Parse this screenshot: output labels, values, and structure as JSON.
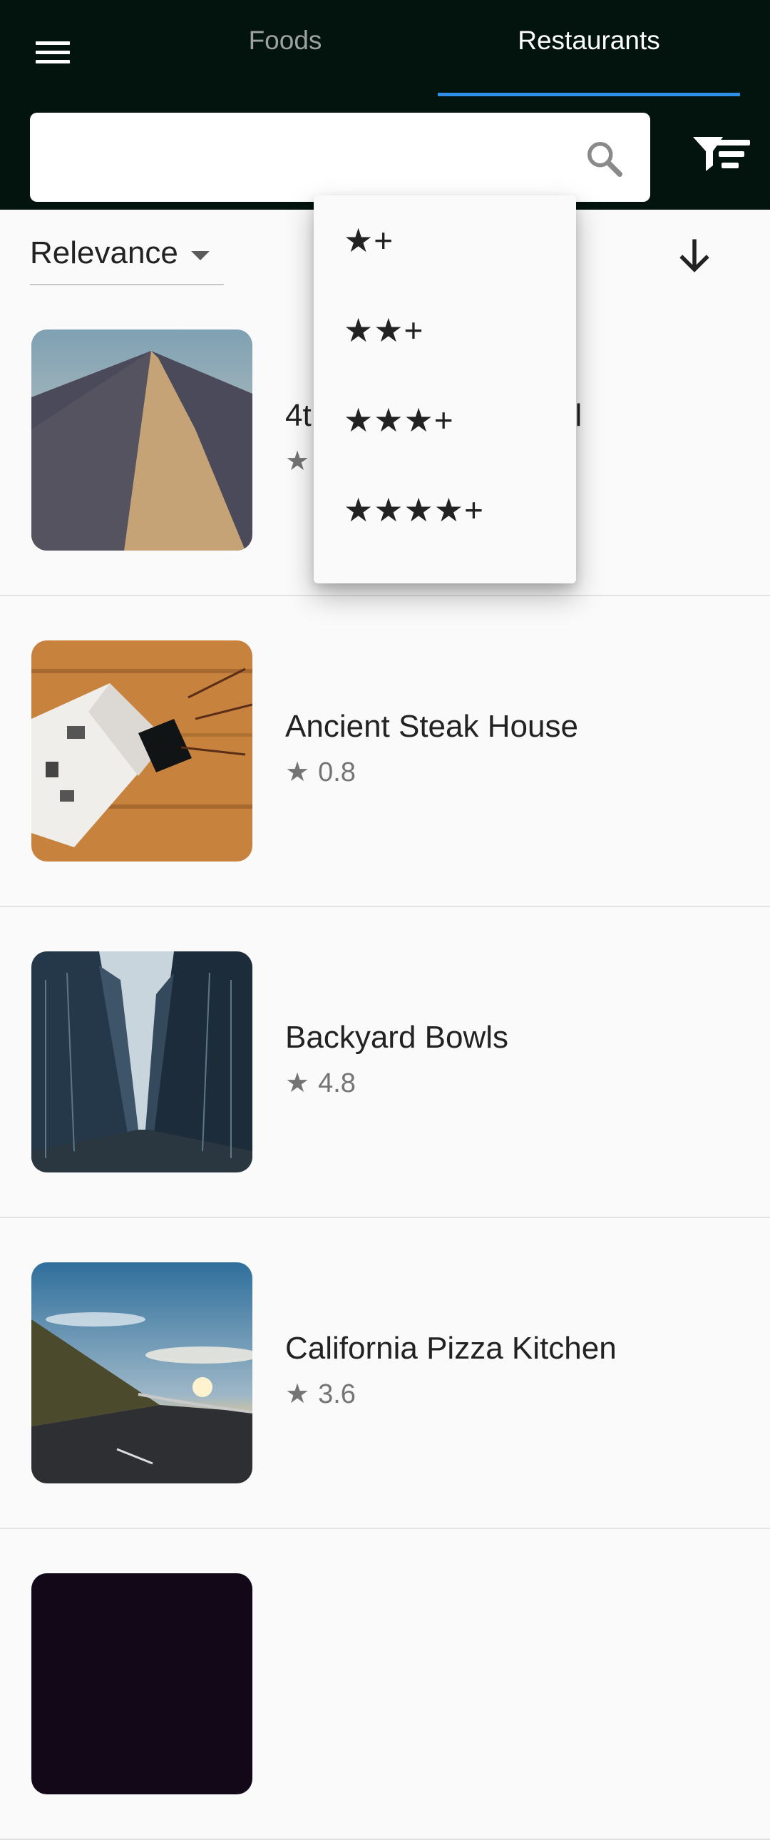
{
  "appbar": {
    "tabs": [
      {
        "label": "Foods",
        "selected": false
      },
      {
        "label": "Restaurants",
        "selected": true
      }
    ],
    "accent_color": "#2f8fe6",
    "background_color": "#03140f"
  },
  "search": {
    "value": "",
    "placeholder": ""
  },
  "sort": {
    "selected": "Relevance"
  },
  "rating_filter_menu": {
    "items": [
      "★+",
      "★★+",
      "★★★+",
      "★★★★+"
    ]
  },
  "restaurants": [
    {
      "name": "4th Street Grill",
      "name_visible": "4t",
      "name_visible_end": "ll",
      "star": "★",
      "rating": "",
      "image": "desert-dune"
    },
    {
      "name": "Ancient Steak House",
      "star": "★",
      "rating": "0.8",
      "image": "book-on-wooden-table"
    },
    {
      "name": "Backyard Bowls",
      "star": "★",
      "rating": "4.8",
      "image": "city-street-skyscrapers"
    },
    {
      "name": "California Pizza Kitchen",
      "star": "★",
      "rating": "3.6",
      "image": "coastal-road-sunset"
    },
    {
      "name": "",
      "star": "",
      "rating": "",
      "image": "dark"
    }
  ]
}
